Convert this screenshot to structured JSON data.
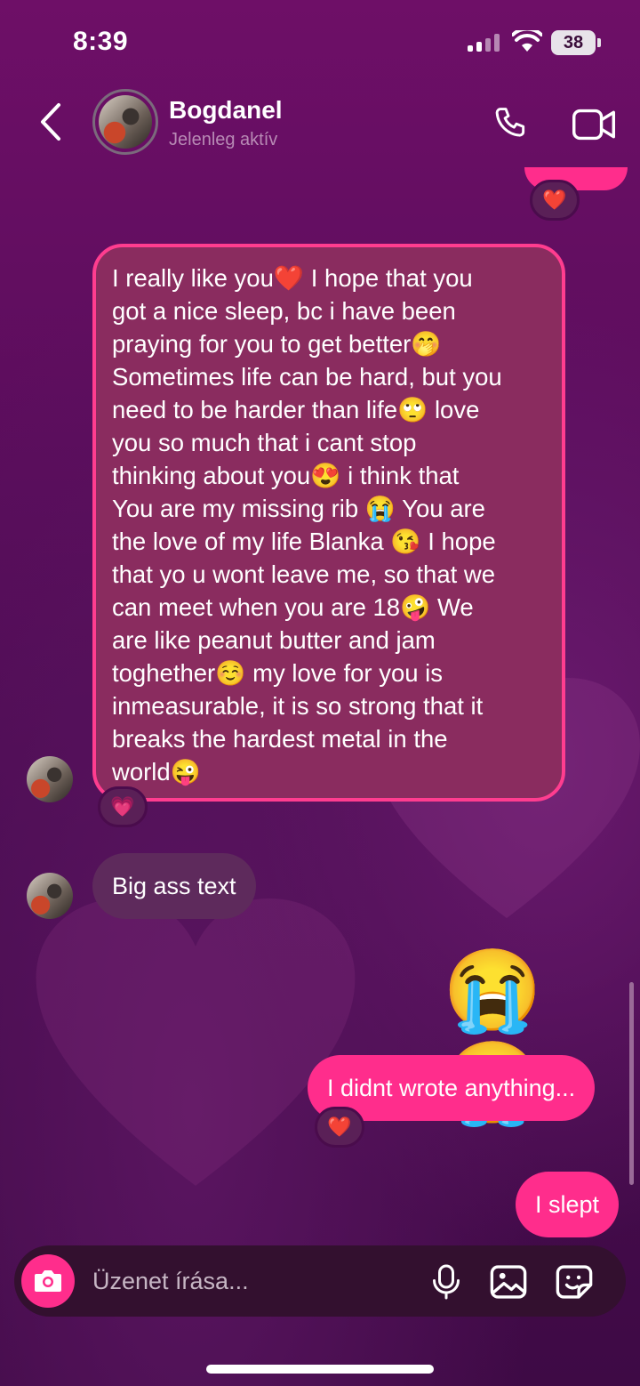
{
  "status_bar": {
    "time": "8:39",
    "battery": "38"
  },
  "header": {
    "name": "Bogdanel",
    "status": "Jelenleg aktív"
  },
  "messages": {
    "top_reaction": "❤️",
    "long_message": {
      "lines": [
        "I really like you❤️  I hope that you",
        "got a nice sleep, bc i have been",
        "praying for you to get better🤭",
        "Sometimes life can be hard, but you",
        "need to be harder than life🙄  love",
        "you so much that i cant stop",
        "thinking about you😍  i think that",
        "You are my missing rib 😭  You are",
        "the love of my life Blanka 😘  I hope",
        "that yo u wont leave me, so that we",
        "can meet when you are 18🤪  We",
        "are like peanut butter and jam",
        "toghether☺️  my love for you is",
        "inmeasurable, it is so strong that it",
        "breaks the hardest metal in the",
        "world😜"
      ],
      "reaction": "💗"
    },
    "received_short": "Big ass text",
    "sent_emojis": "😭😭",
    "sent_1": {
      "text": "I didnt wrote anything...",
      "reaction": "❤️"
    },
    "sent_2": {
      "text": "I slept"
    }
  },
  "composer": {
    "placeholder": "Üzenet írása..."
  },
  "icons": {
    "back": "chevron-left-icon",
    "call": "phone-icon",
    "video": "video-camera-icon",
    "camera": "camera-icon",
    "mic": "microphone-icon",
    "gallery": "image-icon",
    "sticker": "sticker-icon"
  },
  "colors": {
    "accent": "#ff2d8c",
    "bubble_highlight": "#8a2c5f",
    "background": "#5c0d5d"
  }
}
